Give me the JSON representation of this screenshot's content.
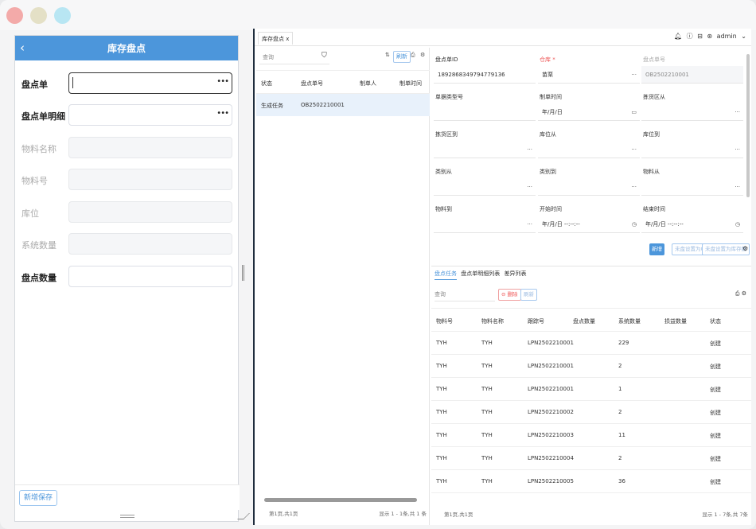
{
  "phone": {
    "title": "库存盘点",
    "back_icon": "chevron-left-icon",
    "fields": [
      {
        "label": "盘点单",
        "value": "",
        "style": "bold",
        "state": "active",
        "has_picker": true
      },
      {
        "label": "盘点单明细",
        "value": "",
        "style": "bold",
        "state": "normal",
        "has_picker": true
      },
      {
        "label": "物料名称",
        "value": "",
        "style": "muted",
        "state": "disabled"
      },
      {
        "label": "物料号",
        "value": "",
        "style": "muted",
        "state": "disabled"
      },
      {
        "label": "库位",
        "value": "",
        "style": "muted",
        "state": "disabled"
      },
      {
        "label": "系统数量",
        "value": "",
        "style": "muted",
        "state": "disabled"
      },
      {
        "label": "盘点数量",
        "value": "",
        "style": "bold",
        "state": "normal"
      }
    ],
    "save_button": "新增保存"
  },
  "app": {
    "tab_label": "库存盘点 x",
    "header_icons": [
      "bell-icon",
      "info-icon",
      "lock-icon",
      "user-icon"
    ],
    "user": "admin",
    "list": {
      "search_placeholder": "查询",
      "refresh": "刷新",
      "columns": [
        "状态",
        "盘点单号",
        "制单人",
        "制单时间"
      ],
      "rows": [
        {
          "status": "生成任务",
          "code": "OB2502210001",
          "maker": "",
          "time": ""
        }
      ],
      "footer_left": "第1页,共1页",
      "footer_right": "显示 1 - 1条,共 1 条"
    },
    "form": {
      "fields": [
        {
          "label": "盘点单ID",
          "value": "1892868349794779136",
          "label_color": "normal",
          "disabled": false
        },
        {
          "label": "仓库",
          "value": "苗栗",
          "label_color": "red",
          "required": true,
          "suffix": "···"
        },
        {
          "label": "盘点单号",
          "value": "OB2502210001",
          "label_color": "muted",
          "disabled": true
        },
        {
          "label": "单据类型号",
          "value": ""
        },
        {
          "label": "制单时间",
          "value": "年/月/日",
          "suffix": "▭"
        },
        {
          "label": "拣货区从",
          "value": "",
          "suffix": "···"
        },
        {
          "label": "拣货区到",
          "value": "",
          "suffix": "···"
        },
        {
          "label": "库位从",
          "value": "",
          "suffix": "···"
        },
        {
          "label": "库位到",
          "value": "",
          "suffix": "···"
        },
        {
          "label": "类别从",
          "value": "",
          "suffix": "···"
        },
        {
          "label": "类别到",
          "value": "",
          "suffix": "···"
        },
        {
          "label": "物料从",
          "value": "",
          "suffix": "···"
        },
        {
          "label": "物料到",
          "value": "",
          "suffix": "···"
        },
        {
          "label": "开始时间",
          "value": "年/月/日 --:--:--",
          "suffix": "◷"
        },
        {
          "label": "结束时间",
          "value": "年/月/日 --:--:--",
          "suffix": "◷"
        }
      ],
      "buttons": {
        "add": "新增",
        "set_zero": "未盘设置为0",
        "set_stock": "未盘设置为库存数"
      }
    },
    "detail": {
      "tabs": [
        "盘点任务",
        "盘点单明细列表",
        "差异列表"
      ],
      "search_placeholder": "查询",
      "delete": "删除",
      "refresh": "刷新",
      "columns": [
        "物料号",
        "物料名称",
        "跟踪号",
        "盘点数量",
        "系统数量",
        "损益数量",
        "状态"
      ],
      "rows": [
        {
          "mat": "TYH",
          "name": "TYH",
          "track": "LPN2502210001",
          "count": "",
          "sys": "229",
          "diff": "",
          "status": "创建"
        },
        {
          "mat": "TYH",
          "name": "TYH",
          "track": "LPN2502210001",
          "count": "",
          "sys": "2",
          "diff": "",
          "status": "创建"
        },
        {
          "mat": "TYH",
          "name": "TYH",
          "track": "LPN2502210001",
          "count": "",
          "sys": "1",
          "diff": "",
          "status": "创建"
        },
        {
          "mat": "TYH",
          "name": "TYH",
          "track": "LPN2502210002",
          "count": "",
          "sys": "2",
          "diff": "",
          "status": "创建"
        },
        {
          "mat": "TYH",
          "name": "TYH",
          "track": "LPN2502210003",
          "count": "",
          "sys": "11",
          "diff": "",
          "status": "创建"
        },
        {
          "mat": "TYH",
          "name": "TYH",
          "track": "LPN2502210004",
          "count": "",
          "sys": "2",
          "diff": "",
          "status": "创建"
        },
        {
          "mat": "TYH",
          "name": "TYH",
          "track": "LPN2502210005",
          "count": "",
          "sys": "36",
          "diff": "",
          "status": "创建"
        }
      ],
      "footer_left": "第1页,共1页",
      "footer_right": "显示 1 - 7条,共 7条"
    }
  }
}
